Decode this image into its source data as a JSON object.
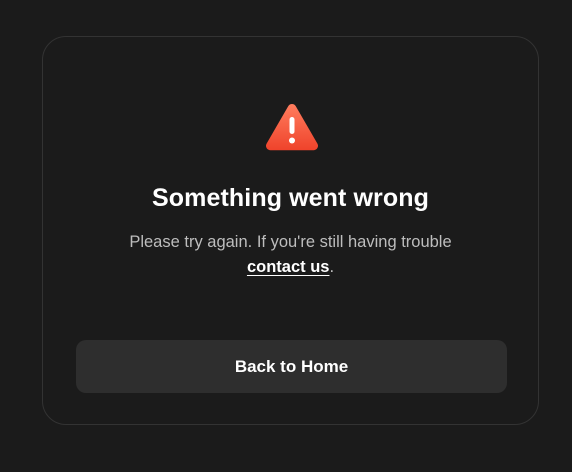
{
  "error": {
    "icon": "warning-triangle-icon",
    "title": "Something went wrong",
    "message_line1": "Please try again. If you're still having trouble",
    "link_label": "contact us",
    "message_end": ".",
    "button_label": "Back to Home"
  },
  "colors": {
    "background": "#1b1b1b",
    "card_border": "#333333",
    "icon_gradient_start": "#ff7a5a",
    "icon_gradient_end": "#f0442c",
    "button_bg": "#2e2e2e",
    "text_primary": "#ffffff",
    "text_secondary": "#bdbdbd"
  }
}
